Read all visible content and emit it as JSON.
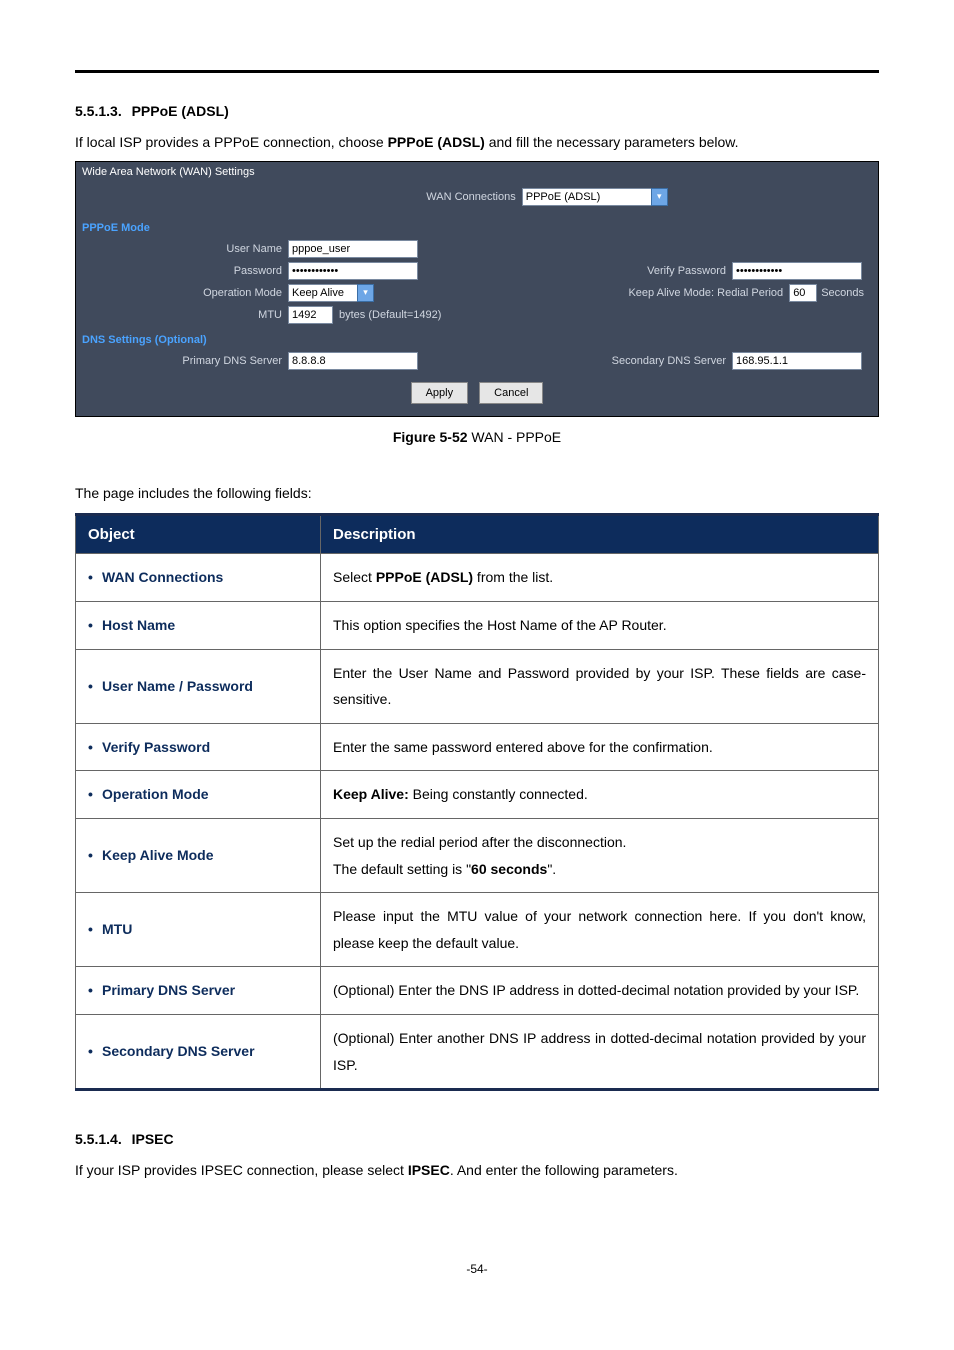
{
  "section1": {
    "number": "5.5.1.3.",
    "title": "PPPoE (ADSL)",
    "intro_pre": "If local ISP provides a PPPoE connection, choose ",
    "intro_bold": "PPPoE (ADSL)",
    "intro_post": " and fill the necessary parameters below."
  },
  "panel": {
    "title": "Wide Area Network (WAN) Settings",
    "wan_conn_label": "WAN Connections",
    "wan_conn_value": "PPPoE (ADSL)",
    "pppoe_mode_hdr": "PPPoE Mode",
    "user_name_label": "User Name",
    "user_name_value": "pppoe_user",
    "password_label": "Password",
    "password_value": "••••••••••••",
    "verify_password_label": "Verify Password",
    "verify_password_value": "••••••••••••",
    "operation_mode_label": "Operation Mode",
    "operation_mode_value": "Keep Alive",
    "keep_alive_label": "Keep Alive Mode: Redial Period",
    "keep_alive_value": "60",
    "keep_alive_unit": "Seconds",
    "mtu_label": "MTU",
    "mtu_value": "1492",
    "mtu_hint": "bytes (Default=1492)",
    "dns_hdr": "DNS Settings (Optional)",
    "primary_dns_label": "Primary DNS Server",
    "primary_dns_value": "8.8.8.8",
    "secondary_dns_label": "Secondary DNS Server",
    "secondary_dns_value": "168.95.1.1",
    "apply_btn": "Apply",
    "cancel_btn": "Cancel"
  },
  "caption": {
    "bold": "Figure 5-52",
    "rest": " WAN - PPPoE"
  },
  "fields_intro": "The page includes the following fields:",
  "table": {
    "hdr_object": "Object",
    "hdr_desc": "Description",
    "rows": [
      {
        "obj": "WAN Connections",
        "desc_pre": "Select ",
        "desc_bold": "PPPoE (ADSL)",
        "desc_post": " from the list."
      },
      {
        "obj": "Host Name",
        "desc": "This option specifies the Host Name of the AP Router."
      },
      {
        "obj": "User Name / Password",
        "desc": "Enter the User Name and Password provided by your ISP. These fields are case-sensitive."
      },
      {
        "obj": "Verify Password",
        "desc": "Enter the same password entered above for the confirmation."
      },
      {
        "obj": "Operation Mode",
        "desc_bold": "Keep Alive:",
        "desc_post": " Being constantly connected."
      },
      {
        "obj": "Keep Alive Mode",
        "desc_pre": "Set up the redial period after the disconnection.\nThe default setting is \"",
        "desc_bold": "60 seconds",
        "desc_post": "\"."
      },
      {
        "obj": "MTU",
        "desc": "Please input the MTU value of your network connection here. If you don't know, please keep the default value."
      },
      {
        "obj": "Primary DNS Server",
        "desc": "(Optional) Enter the DNS IP address in dotted-decimal notation provided by your ISP."
      },
      {
        "obj": "Secondary DNS Server",
        "desc": "(Optional) Enter another DNS IP address in dotted-decimal notation provided by your ISP."
      }
    ]
  },
  "section2": {
    "number": "5.5.1.4.",
    "title": "IPSEC",
    "intro_pre": "If your ISP provides IPSEC connection, please select ",
    "intro_bold": "IPSEC",
    "intro_post": ". And enter the following parameters."
  },
  "page_number": "-54-"
}
